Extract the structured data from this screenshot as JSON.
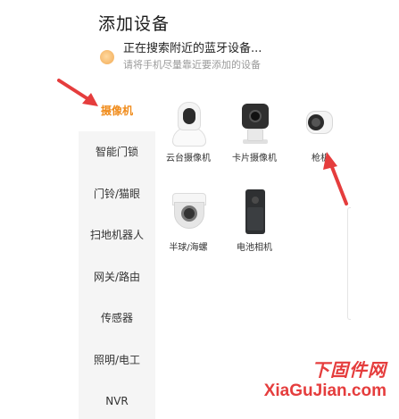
{
  "header": {
    "title": "添加设备"
  },
  "search": {
    "status": "正在搜索附近的蓝牙设备...",
    "hint": "请将手机尽量靠近要添加的设备"
  },
  "sidebar": {
    "items": [
      {
        "label": "摄像机",
        "active": true
      },
      {
        "label": "智能门锁"
      },
      {
        "label": "门铃/猫眼"
      },
      {
        "label": "扫地机器人"
      },
      {
        "label": "网关/路由"
      },
      {
        "label": "传感器"
      },
      {
        "label": "照明/电工"
      },
      {
        "label": "NVR"
      }
    ]
  },
  "devices": [
    {
      "label": "云台摄像机",
      "icon": "pan-tilt-camera-icon"
    },
    {
      "label": "卡片摄像机",
      "icon": "card-camera-icon"
    },
    {
      "label": "枪机",
      "icon": "bullet-camera-icon"
    },
    {
      "label": "半球/海螺",
      "icon": "dome-camera-icon"
    },
    {
      "label": "电池相机",
      "icon": "battery-camera-icon"
    }
  ],
  "colors": {
    "accent": "#f08c1c",
    "annotation": "#e53d3d",
    "sidebar_bg": "#f5f5f5"
  },
  "watermark": {
    "logo": "下固件网",
    "site": "XiaGuJian.com"
  }
}
